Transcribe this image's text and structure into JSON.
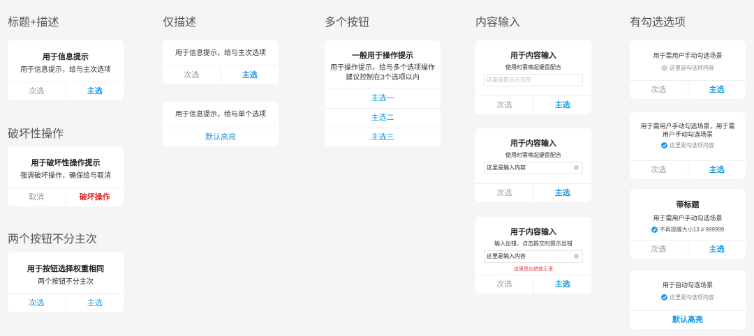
{
  "col1": {
    "title": "标题+描述",
    "card1": {
      "title": "用于信息提示",
      "desc": "用于信息提示，给与主次选项",
      "btn_secondary": "次选",
      "btn_primary": "主选"
    },
    "title2": "破坏性操作",
    "card2": {
      "title": "用于破坏性操作提示",
      "desc": "强调破坏操作，确保给与取消",
      "btn_cancel": "取消",
      "btn_destroy": "破坏操作"
    },
    "title3": "两个按钮不分主次",
    "card3": {
      "title": "用于按钮选择权重相同",
      "desc": "两个按钮不分主次",
      "btn_a": "次选",
      "btn_b": "主选"
    }
  },
  "col2": {
    "title": "仅描述",
    "card1": {
      "desc": "用于信息提示，给与主次选项",
      "btn_secondary": "次选",
      "btn_primary": "主选"
    },
    "card2": {
      "desc": "用于信息提示，给与单个选项",
      "btn_single": "默认高亮"
    }
  },
  "col3": {
    "title": "多个按钮",
    "card1": {
      "title": "一般用于操作提示",
      "desc1": "用于操作提示，给与多个选项操作",
      "desc2": "建议控制在3个选项以内",
      "buttons": [
        "主选一",
        "主选二",
        "主选三"
      ]
    }
  },
  "col4": {
    "title": "内容输入",
    "card1": {
      "title": "用于内容输入",
      "desc": "使用时需唤起键盘配合",
      "placeholder": "这里是提示占位符",
      "btn_secondary": "次选",
      "btn_primary": "主选"
    },
    "card2": {
      "title": "用于内容输入",
      "desc": "使用时需唤起键盘配合",
      "value": "这里是输入内容",
      "btn_secondary": "次选",
      "btn_primary": "主选"
    },
    "card3": {
      "title": "用于内容输入",
      "desc": "输入出错，点击提交时提示出错",
      "value": "这里是输入内容",
      "error": "这里是出错提示语",
      "btn_secondary": "次选",
      "btn_primary": "主选"
    }
  },
  "col5": {
    "title": "有勾选选项",
    "card1": {
      "title": "用于需用户手动勾选场景",
      "check": "这里是勾选项内容",
      "btn_secondary": "次选",
      "btn_primary": "主选"
    },
    "card2": {
      "title1": "用于需用户手动勾选场景，用于需",
      "title2": "用户手动勾选场景",
      "check": "这里是勾选项内容",
      "btn_secondary": "次选",
      "btn_primary": "主选"
    },
    "card3": {
      "heading": "带标题",
      "title": "用于需用户手动勾选场景",
      "check": "不再提醒大小13 # 999999",
      "btn_secondary": "次选",
      "btn_primary": "主选"
    },
    "card4": {
      "title": "用于自动勾选场景",
      "check": "这里是勾选项内容",
      "btn_single": "默认高亮"
    }
  },
  "colors": {
    "background": "#f5f5f5",
    "primary": "#1a9be6",
    "danger": "#e02424",
    "secondary": "#999999"
  }
}
